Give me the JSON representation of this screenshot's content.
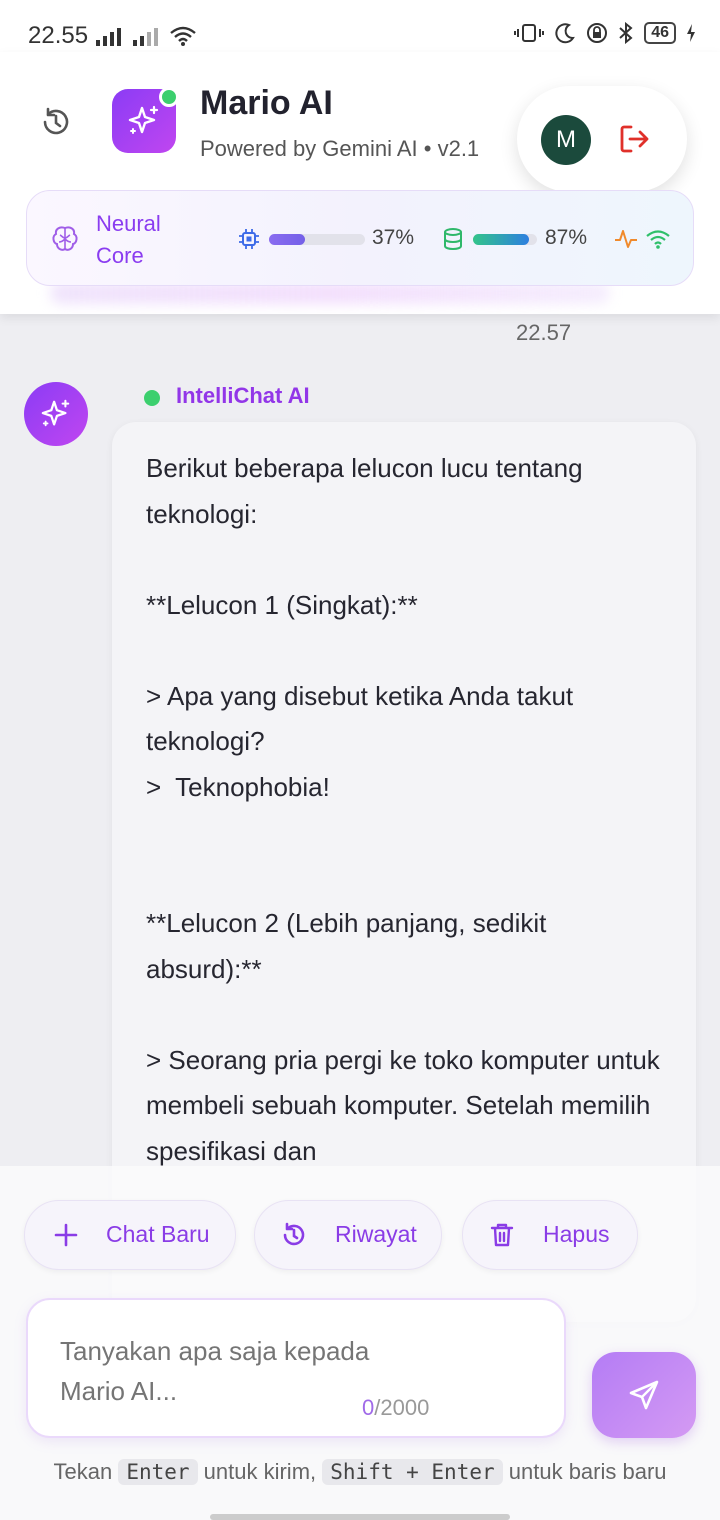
{
  "status_bar": {
    "time": "22.55",
    "battery": "46"
  },
  "header": {
    "title": "Mario AI",
    "subtitle": "Powered by Gemini AI • v2.1",
    "avatar_initial": "M"
  },
  "neural_core": {
    "label": "Neural Core",
    "cpu_percent_label": "37%",
    "cpu_level": 0.37,
    "memory_percent_label": "87%",
    "memory_level": 0.87
  },
  "chat": {
    "timestamp": "22.57",
    "bot_name": "IntelliChat AI",
    "message": "Berikut beberapa lelucon lucu tentang teknologi:\n\n**Lelucon 1 (Singkat):**\n\n> Apa yang disebut ketika Anda takut teknologi?\n>  Teknophobia!\n\n\n**Lelucon 2 (Lebih panjang, sedikit absurd):**\n\n> Seorang pria pergi ke toko komputer untuk membeli sebuah komputer. Setelah memilih spesifikasi dan"
  },
  "actions": {
    "new_chat": "Chat Baru",
    "history": "Riwayat",
    "delete": "Hapus"
  },
  "input": {
    "placeholder": "Tanyakan apa saja kepada Mario AI...",
    "count_current": "0",
    "count_max": "/2000"
  },
  "hint": {
    "prefix": "Tekan",
    "key_send": "Enter",
    "mid": "untuk kirim,",
    "key_newline": "Shift + Enter",
    "suffix": "untuk baris baru"
  },
  "colors": {
    "accent": "#8a3cf0",
    "online": "#3ccf6e",
    "logout": "#e0302a"
  }
}
